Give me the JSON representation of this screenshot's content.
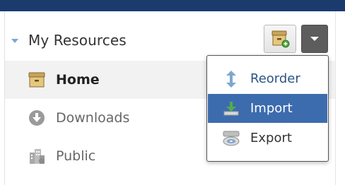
{
  "header": {
    "title": "My Resources",
    "new_resource_icon": "archive-box-plus-icon",
    "menu_toggle_icon": "chevron-down-icon"
  },
  "nav": {
    "items": [
      {
        "label": "Home",
        "icon": "archive-box-icon",
        "active": true
      },
      {
        "label": "Downloads",
        "icon": "download-circle-icon",
        "active": false
      },
      {
        "label": "Public",
        "icon": "buildings-icon",
        "active": false
      }
    ]
  },
  "menu": {
    "items": [
      {
        "label": "Reorder",
        "icon": "vertical-arrows-icon"
      },
      {
        "label": "Import",
        "icon": "import-tray-icon",
        "selected": true
      },
      {
        "label": "Export",
        "icon": "disc-drive-icon"
      }
    ]
  },
  "colors": {
    "top_bar": "#1b3a6e",
    "accent": "#3d6cae",
    "caret": "#7fa6d1",
    "reorder_text": "#2d5487"
  }
}
